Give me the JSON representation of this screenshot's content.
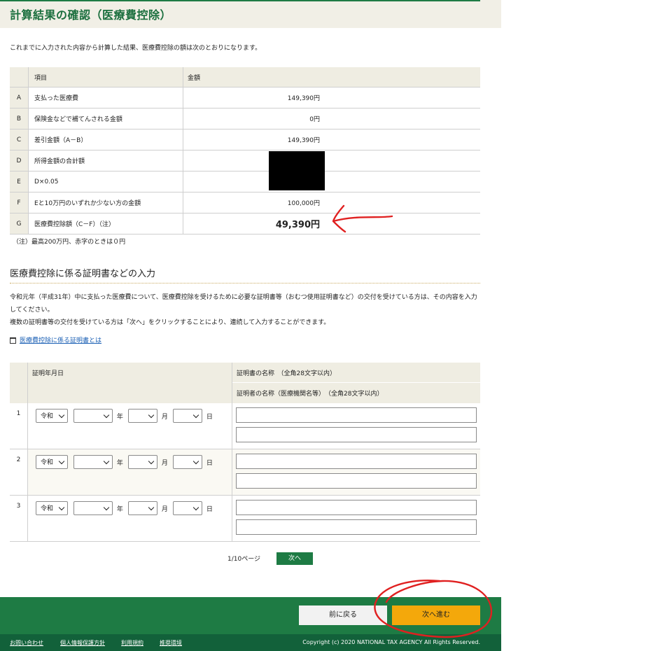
{
  "title": "計算結果の確認（医療費控除）",
  "intro": "これまでに入力された内容から計算した結果、医療費控除の額は次のとおりになります。",
  "result_table": {
    "headers": {
      "item": "項目",
      "amount": "金額"
    },
    "rows": [
      {
        "key": "A",
        "label": "支払った医療費",
        "value": "149,390円"
      },
      {
        "key": "B",
        "label": "保険金などで補てんされる金額",
        "value": "0円"
      },
      {
        "key": "C",
        "label": "差引金額（A－B）",
        "value": "149,390円"
      },
      {
        "key": "D",
        "label": "所得金額の合計額",
        "value": ""
      },
      {
        "key": "E",
        "label": "D×0.05",
        "value": ""
      },
      {
        "key": "F",
        "label": "Eと10万円のいずれか少ない方の金額",
        "value": "100,000円"
      },
      {
        "key": "G",
        "label": "医療費控除額（C－F）（注）",
        "value": "49,390円"
      }
    ]
  },
  "note": "（注）最高200万円、赤字のときは０円",
  "section": {
    "title": "医療費控除に係る証明書などの入力",
    "desc1": "令和元年（平成31年）中に支払った医療費について、医療費控除を受けるために必要な証明書等（おむつ使用証明書など）の交付を受けている方は、その内容を入力してください。",
    "desc2": "複数の証明書等の交付を受けている方は「次へ」をクリックすることにより、連続して入力することができます。",
    "link": "医療費控除に係る証明書とは"
  },
  "cert_table": {
    "date_header": "証明年月日",
    "name_header1": "証明書の名称　（全角28文字以内）",
    "name_header2": "証明者の名称（医療機関名等）　（全角28文字以内）",
    "era_value": "令和",
    "unit_year": "年",
    "unit_month": "月",
    "unit_day": "日",
    "rows": [
      "1",
      "2",
      "3"
    ]
  },
  "pager": {
    "text": "1/10ページ",
    "next": "次へ"
  },
  "footer": {
    "back": "前に戻る",
    "next": "次へ進む",
    "links": [
      "お問い合わせ",
      "個人情報保護方針",
      "利用規約",
      "推奨環境"
    ],
    "copyright": "Copyright (c) 2020 NATIONAL TAX AGENCY All Rights Reserved."
  },
  "annotation_color": "#e02020"
}
